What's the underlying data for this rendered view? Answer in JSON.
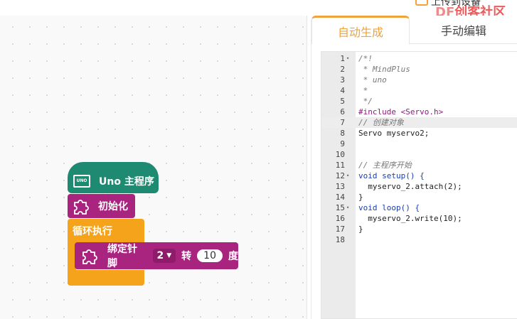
{
  "header": {
    "upload_label": "上传到设备",
    "logo_text_df": "DF",
    "logo_text": "创客社区"
  },
  "tabs": [
    {
      "label": "自动生成",
      "active": true
    },
    {
      "label": "手动编辑",
      "active": false
    }
  ],
  "blocks": {
    "hat_label": "Uno 主程序",
    "board_icon_text": "UNO",
    "init_label": "初始化",
    "loop_label": "循环执行",
    "servo_bind_label": "绑定针脚",
    "servo_pin": "2",
    "servo_turn_label": "转",
    "servo_angle": "10",
    "servo_deg_label": "度"
  },
  "code_lines": [
    {
      "n": "1",
      "fold": "▾",
      "text": "/*!",
      "cls": "c-com"
    },
    {
      "n": "2",
      "fold": "",
      "text": " * MindPlus",
      "cls": "c-com"
    },
    {
      "n": "3",
      "fold": "",
      "text": " * uno",
      "cls": "c-com"
    },
    {
      "n": "4",
      "fold": "",
      "text": " *",
      "cls": "c-com"
    },
    {
      "n": "5",
      "fold": "",
      "text": " */",
      "cls": "c-com"
    },
    {
      "n": "6",
      "fold": "",
      "text": "#include <Servo.h>",
      "cls": "c-inc"
    },
    {
      "n": "7",
      "fold": "",
      "text": "// 创建对象",
      "cls": "c-com"
    },
    {
      "n": "8",
      "fold": "",
      "text": "Servo myservo2;",
      "cls": ""
    },
    {
      "n": "9",
      "fold": "",
      "text": "",
      "cls": ""
    },
    {
      "n": "10",
      "fold": "",
      "text": "",
      "cls": ""
    },
    {
      "n": "11",
      "fold": "",
      "text": "// 主程序开始",
      "cls": "c-com"
    },
    {
      "n": "12",
      "fold": "▾",
      "text": "void setup() {",
      "cls": "c-kw"
    },
    {
      "n": "13",
      "fold": "",
      "text": "  myservo_2.attach(2);",
      "cls": ""
    },
    {
      "n": "14",
      "fold": "",
      "text": "}",
      "cls": ""
    },
    {
      "n": "15",
      "fold": "▾",
      "text": "void loop() {",
      "cls": "c-kw"
    },
    {
      "n": "16",
      "fold": "",
      "text": "  myservo_2.write(10);",
      "cls": ""
    },
    {
      "n": "17",
      "fold": "",
      "text": "}",
      "cls": ""
    },
    {
      "n": "18",
      "fold": "",
      "text": "",
      "cls": ""
    }
  ],
  "colors": {
    "accent": "#f0a23b",
    "hat_block": "#1e8a72",
    "function_block": "#a9247f",
    "loop_block": "#f5a31a"
  },
  "icons": {
    "puzzle": "puzzle-icon",
    "board": "uno-board-icon",
    "upload": "upload-icon"
  }
}
